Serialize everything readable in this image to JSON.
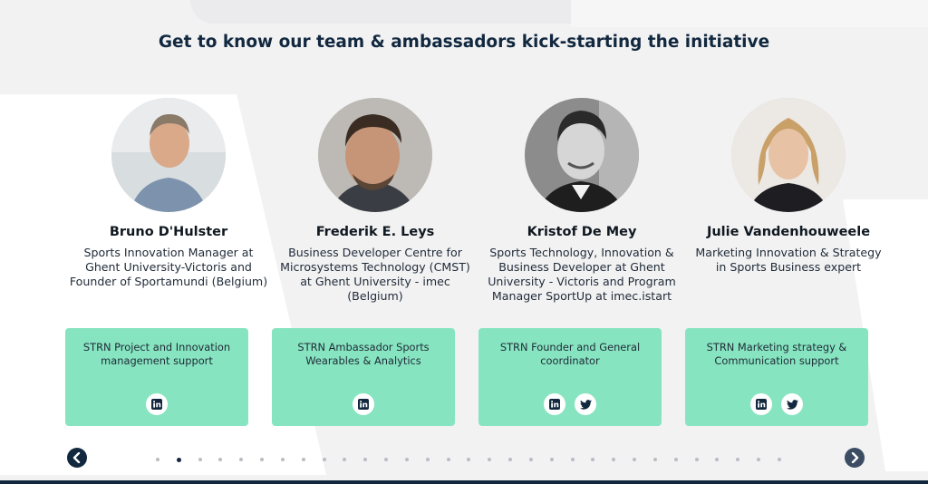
{
  "heading": "Get to know our team & ambassadors kick-starting the initiative",
  "team": [
    {
      "name": "Bruno D'Hulster",
      "role": "Sports Innovation Manager at Ghent University-Victoris and Founder of Sportamundi (Belgium)",
      "box_text": "STRN Project and Innovation management support",
      "socials": [
        "linkedin"
      ]
    },
    {
      "name": "Frederik E. Leys",
      "role": "Business Developer Centre for Microsystems Technology (CMST) at Ghent University - imec (Belgium)",
      "box_text": "STRN Ambassador Sports Wearables & Analytics",
      "socials": [
        "linkedin"
      ]
    },
    {
      "name": "Kristof De Mey",
      "role": "Sports Technology, Innovation & Business Developer at Ghent University - Victoris and Program Manager SportUp at imec.istart",
      "box_text": "STRN Founder and General coordinator",
      "socials": [
        "linkedin",
        "twitter"
      ]
    },
    {
      "name": "Julie Vandenhouweele",
      "role": "Marketing Innovation & Strategy in Sports Business expert",
      "box_text": "STRN Marketing strategy & Communication support",
      "socials": [
        "linkedin",
        "twitter"
      ]
    }
  ],
  "carousel": {
    "prev_icon": "chevron-left-icon",
    "next_icon": "chevron-right-icon",
    "dot_count": 31,
    "active_dot": 2
  },
  "colors": {
    "heading": "#12283f",
    "box": "#87e4c0",
    "nav": "#12283f"
  }
}
